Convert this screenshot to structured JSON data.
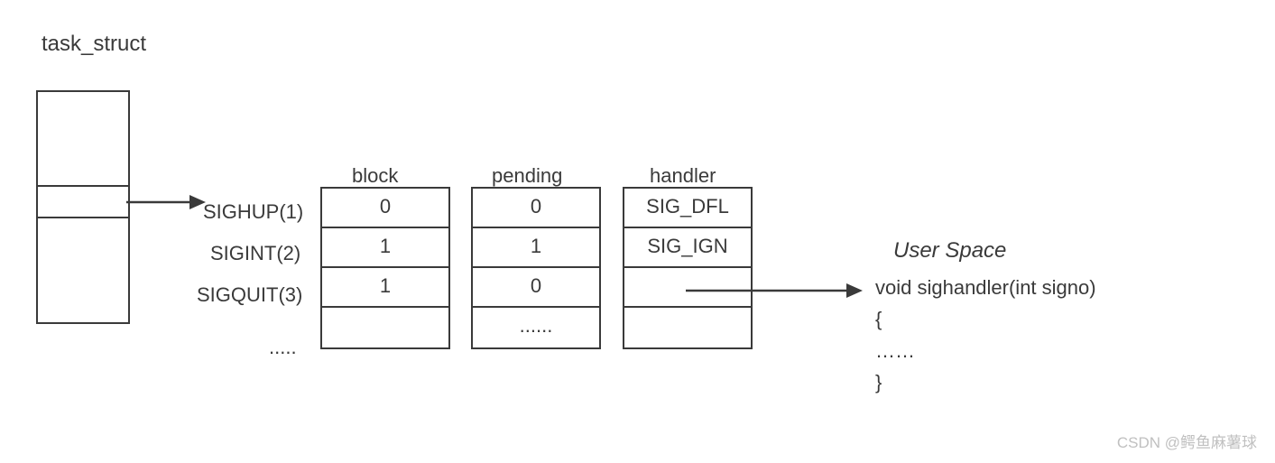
{
  "title": "task_struct",
  "struct_box": {
    "rows": 3
  },
  "signals": [
    {
      "name": "SIGHUP(1)"
    },
    {
      "name": "SIGINT(2)"
    },
    {
      "name": "SIGQUIT(3)"
    },
    {
      "name": "....."
    }
  ],
  "tables": {
    "block": {
      "header": "block",
      "rows": [
        "0",
        "1",
        "1",
        ""
      ]
    },
    "pending": {
      "header": "pending",
      "rows": [
        "0",
        "1",
        "0",
        "......"
      ]
    },
    "handler": {
      "header": "handler",
      "rows": [
        "SIG_DFL",
        "SIG_IGN",
        "",
        ""
      ]
    }
  },
  "user_space": {
    "title": "User Space",
    "code": [
      "void sighandler(int signo)",
      "{",
      "……",
      "}"
    ]
  },
  "watermark": "CSDN @鳄鱼麻薯球"
}
